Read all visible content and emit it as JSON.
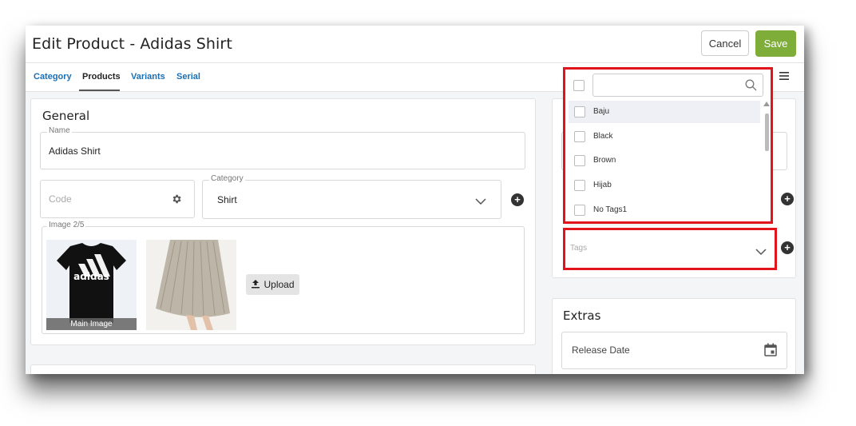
{
  "header": {
    "title": "Edit Product - Adidas Shirt",
    "cancel_label": "Cancel",
    "save_label": "Save",
    "save_color": "#7fad39"
  },
  "tabs": [
    {
      "label": "Category",
      "active": false
    },
    {
      "label": "Products",
      "active": true
    },
    {
      "label": "Variants",
      "active": false
    },
    {
      "label": "Serial",
      "active": false
    }
  ],
  "general": {
    "title": "General",
    "name_label": "Name",
    "name_value": "Adidas Shirt",
    "code_placeholder": "Code",
    "category_label": "Category",
    "category_value": "Shirt",
    "image_label": "Image 2/5",
    "main_image_caption": "Main Image",
    "thumb1_text": "adidas",
    "upload_label": "Upload"
  },
  "tags_dropdown": {
    "items": [
      "Baju",
      "Black",
      "Brown",
      "Hijab",
      "No Tags1"
    ],
    "highlighted": "Baju",
    "placeholder": "Tags"
  },
  "extras": {
    "title": "Extras",
    "release_date_placeholder": "Release Date"
  },
  "icons": [
    "gear-icon",
    "chevron-down-icon",
    "plus-circle-icon",
    "search-icon",
    "menu-icon",
    "calendar-icon",
    "upload-icon"
  ],
  "colors": {
    "accent_link": "#1a6fb5",
    "highlight_box": "#e1141c"
  }
}
